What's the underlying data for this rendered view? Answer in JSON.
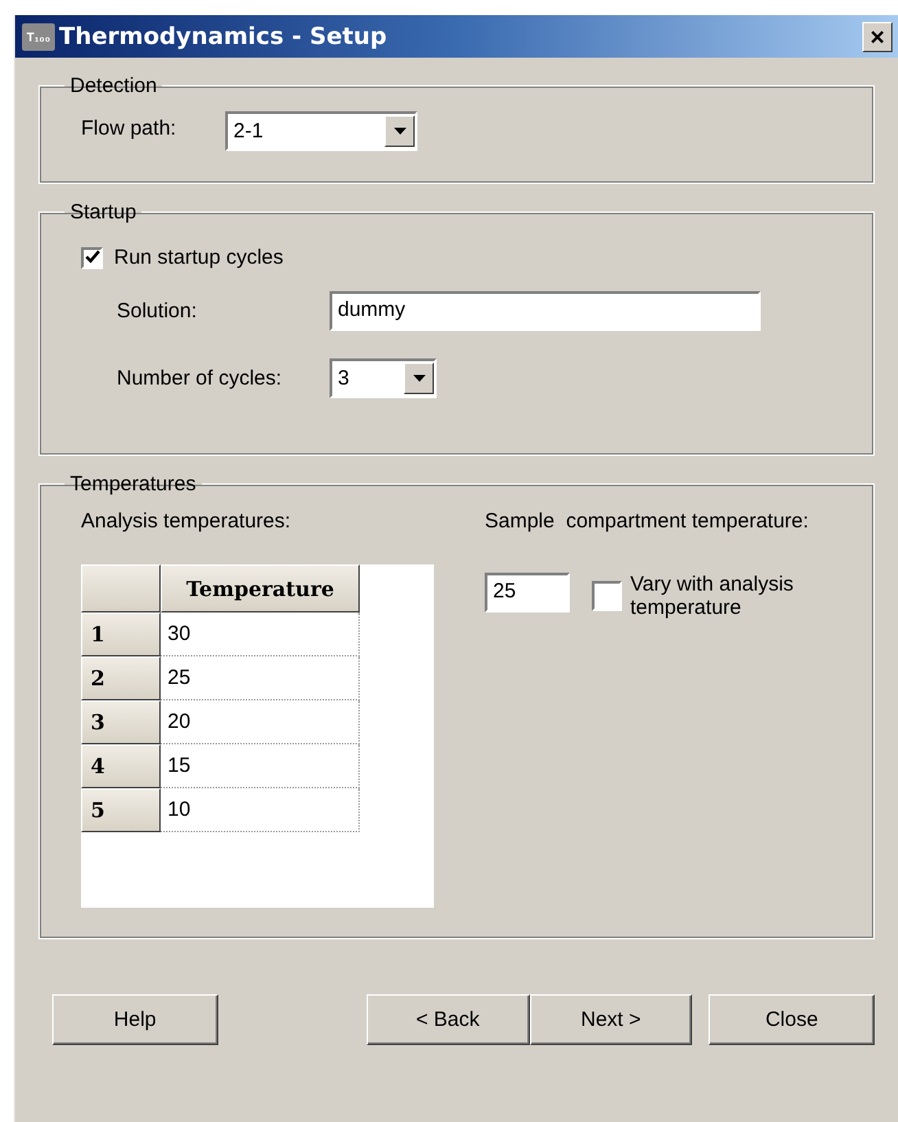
{
  "window": {
    "title": "Thermodynamics - Setup",
    "icon_text": "T₁₀₀",
    "close": "×"
  },
  "detection": {
    "title": "Detection",
    "flow_path": {
      "label": "Flow path:",
      "value": "2-1"
    }
  },
  "startup": {
    "title": "Startup",
    "run_cycles": {
      "label": "Run startup cycles",
      "checked": true
    },
    "solution": {
      "label": "Solution:",
      "value": "dummy"
    },
    "cycles": {
      "label": "Number of cycles:",
      "value": "3"
    }
  },
  "temperatures": {
    "title": "Temperatures",
    "analysis_label": "Analysis temperatures:",
    "table": {
      "columns": [
        "Temperature"
      ],
      "rows": [
        {
          "index": "1",
          "value": "30"
        },
        {
          "index": "2",
          "value": "25"
        },
        {
          "index": "3",
          "value": "20"
        },
        {
          "index": "4",
          "value": "15"
        },
        {
          "index": "5",
          "value": "10"
        }
      ]
    },
    "sample_label": "Sample  compartment temperature:",
    "sample_value": "25",
    "vary": {
      "label": "Vary with analysis temperature",
      "checked": false
    }
  },
  "buttons": [
    "Help",
    "< Back",
    "Next >",
    "Close"
  ]
}
